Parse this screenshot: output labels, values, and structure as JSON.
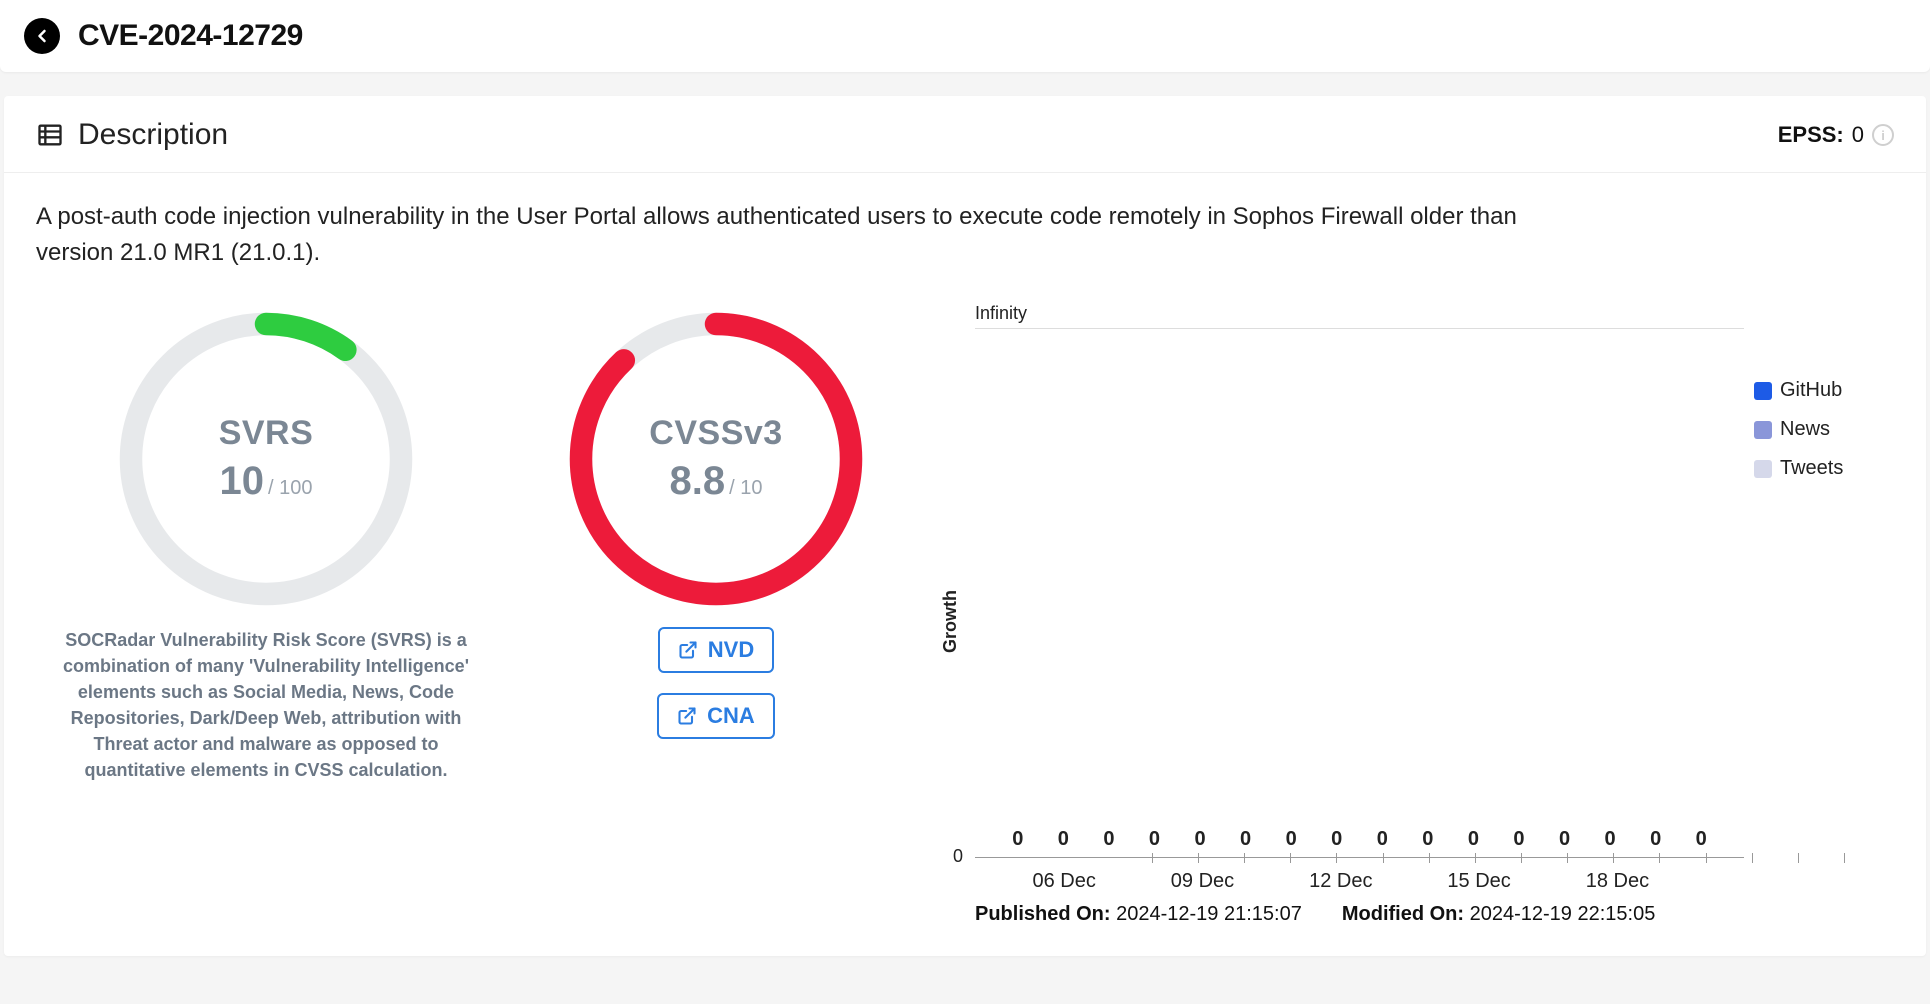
{
  "header": {
    "cve": "CVE-2024-12729"
  },
  "section_title": "Description",
  "epss": {
    "label": "EPSS:",
    "value": "0"
  },
  "description": "A post-auth code injection vulnerability in the User Portal allows authenticated users to execute code remotely in Sophos Firewall older than version 21.0 MR1 (21.0.1).",
  "svrs": {
    "label": "SVRS",
    "value": "10",
    "max": "/ 100",
    "percent": 10,
    "color": "#2ecc40",
    "note": "SOCRadar Vulnerability Risk Score (SVRS) is a combination of many 'Vulnerability Intelligence' elements such as Social Media, News, Code Repositories, Dark/Deep Web, attribution with Threat actor and malware as opposed to quantitative elements in CVSS calculation."
  },
  "cvss": {
    "label": "CVSSv3",
    "value": "8.8",
    "max": "/ 10",
    "percent": 88,
    "color": "#ed1b3a",
    "links": {
      "nvd": "NVD",
      "cna": "CNA"
    }
  },
  "chart_data": {
    "type": "bar",
    "ylabel": "Growth",
    "ytop": "Infinity",
    "yorigin": "0",
    "categories": [
      "",
      "06 Dec",
      "",
      "",
      "09 Dec",
      "",
      "",
      "12 Dec",
      "",
      "",
      "15 Dec",
      "",
      "",
      "18 Dec",
      "",
      ""
    ],
    "series": [
      {
        "name": "GitHub",
        "color": "#1d5be6",
        "values": [
          0,
          0,
          0,
          0,
          0,
          0,
          0,
          0,
          0,
          0,
          0,
          0,
          0,
          0,
          0,
          0
        ]
      },
      {
        "name": "News",
        "color": "#8a96d9",
        "values": [
          0,
          0,
          0,
          0,
          0,
          0,
          0,
          0,
          0,
          0,
          0,
          0,
          0,
          0,
          0,
          0
        ]
      },
      {
        "name": "Tweets",
        "color": "#d5d8ea",
        "values": [
          0,
          0,
          0,
          0,
          0,
          0,
          0,
          0,
          0,
          0,
          0,
          0,
          0,
          0,
          0,
          0
        ]
      }
    ]
  },
  "meta": {
    "published_label": "Published On:",
    "published_value": "2024-12-19 21:15:07",
    "modified_label": "Modified On:",
    "modified_value": "2024-12-19 22:15:05"
  }
}
